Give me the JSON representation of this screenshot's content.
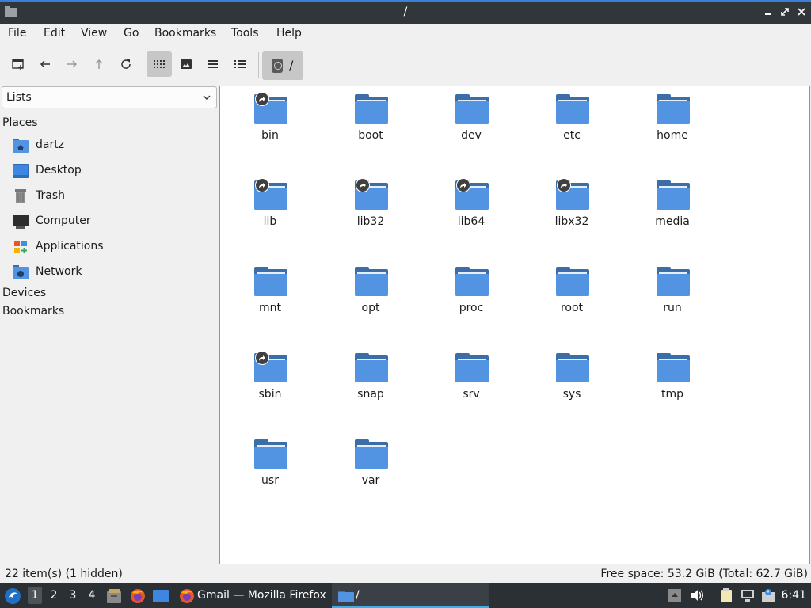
{
  "window": {
    "title": "/"
  },
  "menu": [
    "File",
    "Edit",
    "View",
    "Go",
    "Bookmarks",
    "Tools",
    "Help"
  ],
  "path": {
    "label": "/"
  },
  "side_pane": {
    "mode": "Lists",
    "places_header": "Places",
    "places": [
      {
        "label": "dartz",
        "icon": "home-folder-icon"
      },
      {
        "label": "Desktop",
        "icon": "desktop-icon"
      },
      {
        "label": "Trash",
        "icon": "trash-icon"
      },
      {
        "label": "Computer",
        "icon": "computer-icon"
      },
      {
        "label": "Applications",
        "icon": "applications-icon"
      },
      {
        "label": "Network",
        "icon": "network-icon"
      }
    ],
    "devices_header": "Devices",
    "bookmarks_header": "Bookmarks"
  },
  "items": [
    {
      "name": "bin",
      "symlink": true
    },
    {
      "name": "boot",
      "symlink": false
    },
    {
      "name": "dev",
      "symlink": false
    },
    {
      "name": "etc",
      "symlink": false
    },
    {
      "name": "home",
      "symlink": false
    },
    {
      "name": "lib",
      "symlink": true
    },
    {
      "name": "lib32",
      "symlink": true
    },
    {
      "name": "lib64",
      "symlink": true
    },
    {
      "name": "libx32",
      "symlink": true
    },
    {
      "name": "media",
      "symlink": false
    },
    {
      "name": "mnt",
      "symlink": false
    },
    {
      "name": "opt",
      "symlink": false
    },
    {
      "name": "proc",
      "symlink": false
    },
    {
      "name": "root",
      "symlink": false
    },
    {
      "name": "run",
      "symlink": false
    },
    {
      "name": "sbin",
      "symlink": true
    },
    {
      "name": "snap",
      "symlink": false
    },
    {
      "name": "srv",
      "symlink": false
    },
    {
      "name": "sys",
      "symlink": false
    },
    {
      "name": "tmp",
      "symlink": false
    },
    {
      "name": "usr",
      "symlink": false
    },
    {
      "name": "var",
      "symlink": false
    }
  ],
  "status": {
    "left": "22 item(s) (1 hidden)",
    "right": "Free space: 53.2 GiB (Total: 62.7 GiB)"
  },
  "taskbar": {
    "workspaces": [
      "1",
      "2",
      "3",
      "4"
    ],
    "active_workspace": "1",
    "tasks": [
      {
        "label": "Gmail — Mozilla Firefox",
        "icon": "firefox-icon"
      },
      {
        "label": "/",
        "icon": "folder-icon"
      }
    ],
    "clock": "6:41"
  },
  "colors": {
    "accent": "#3daee9",
    "folder": "#5294e2",
    "folder_dark": "#3b6ea8",
    "titlebar": "#31363b"
  }
}
